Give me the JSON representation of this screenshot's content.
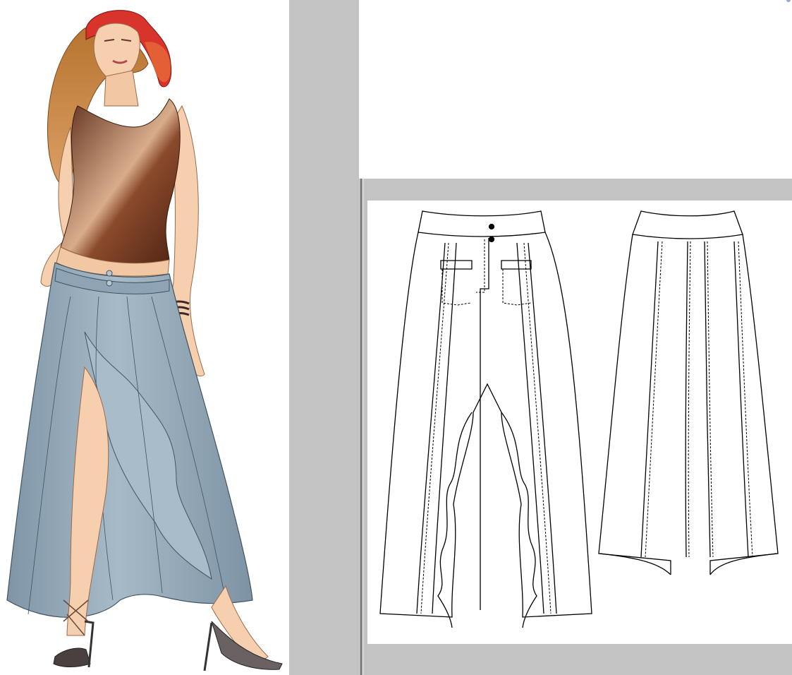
{
  "colors": {
    "gray": "#c3c3c3",
    "skin": "#f6cfae",
    "hair": "#c9853f",
    "scarf": "#d8342c",
    "top": "#6e3520",
    "skirt": "#93a8b8",
    "line": "#000000"
  },
  "top_canvas": {
    "caption": ""
  },
  "illustration": {
    "subject": "fashion-figure-wrap-ruffle-skirt"
  },
  "flats": {
    "views": [
      "front",
      "back"
    ]
  }
}
